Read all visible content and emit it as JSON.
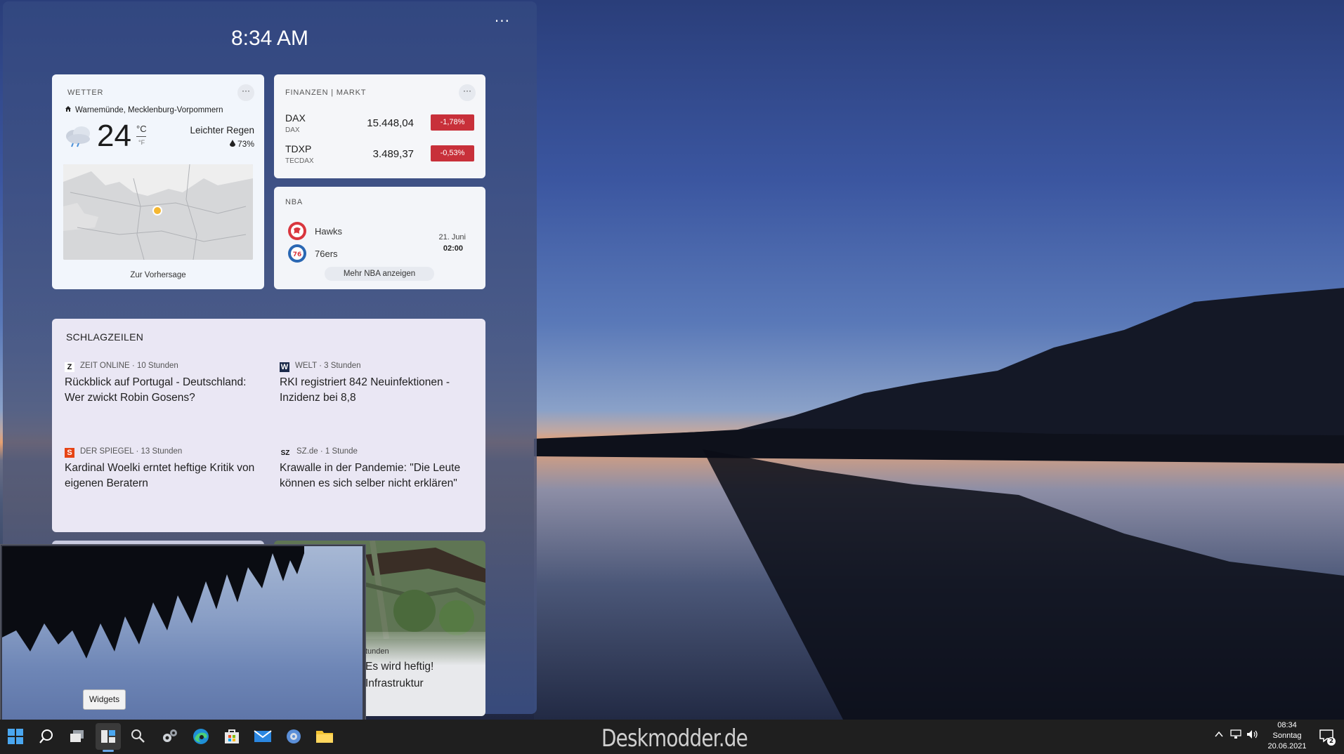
{
  "panel": {
    "time": "8:34 AM",
    "more": "···"
  },
  "weather": {
    "title": "WETTER",
    "more": "···",
    "location": "Warnemünde, Mecklenburg-Vorpommern",
    "temperature": "24",
    "unit_c": "°C",
    "unit_f": "°F",
    "condition": "Leichter Regen",
    "humidity": "73%",
    "forecast_link": "Zur Vorhersage"
  },
  "finance": {
    "title": "FINANZEN | MARKT",
    "more": "···",
    "rows": [
      {
        "symbol": "DAX",
        "sub": "DAX",
        "value": "15.448,04",
        "change": "-1,78%"
      },
      {
        "symbol": "TDXP",
        "sub": "TECDAX",
        "value": "3.489,37",
        "change": "-0,53%"
      }
    ],
    "negative_color": "#c8303a"
  },
  "nba": {
    "title": "NBA",
    "teams": [
      {
        "name": "Hawks",
        "icon": "hawks-logo-icon"
      },
      {
        "name": "76ers",
        "icon": "76ers-logo-icon"
      }
    ],
    "date": "21. Juni",
    "time": "02:00",
    "more_link": "Mehr NBA anzeigen"
  },
  "headlines": {
    "title": "SCHLAGZEILEN",
    "items": [
      {
        "badge": "Z",
        "source": "ZEIT ONLINE · 10 Stunden",
        "headline": "Rückblick auf Portugal - Deutschland: Wer zwickt Robin Gosens?"
      },
      {
        "badge": "W",
        "source": "WELT · 3 Stunden",
        "headline": "RKI registriert 842 Neuinfektionen - Inzidenz bei 8,8"
      },
      {
        "badge": "S",
        "source": "DER SPIEGEL · 13 Stunden",
        "headline": "Kardinal Woelki erntet heftige Kritik von eigenen Beratern"
      },
      {
        "badge": "SZ",
        "source": "SZ.de · 1 Stunde",
        "headline": "Krawalle in der Pandemie: \"Die Leute können es sich selber nicht erklären\""
      }
    ]
  },
  "preview": {
    "right_source": "tunden",
    "right_headline": "Es wird heftig! Infrastruktur"
  },
  "tooltip": "Widgets",
  "taskbar": {
    "icons": [
      "start-icon",
      "search-icon",
      "task-view-icon",
      "widgets-icon",
      "magnifier-icon",
      "settings-gears-icon",
      "edge-browser-icon",
      "store-icon",
      "mail-icon",
      "control-panel-icon",
      "file-explorer-icon"
    ],
    "watermark": "Deskmodder.de",
    "clock_time": "08:34",
    "clock_day": "Sonntag",
    "clock_date": "20.06.2021",
    "notification_count": "2"
  }
}
